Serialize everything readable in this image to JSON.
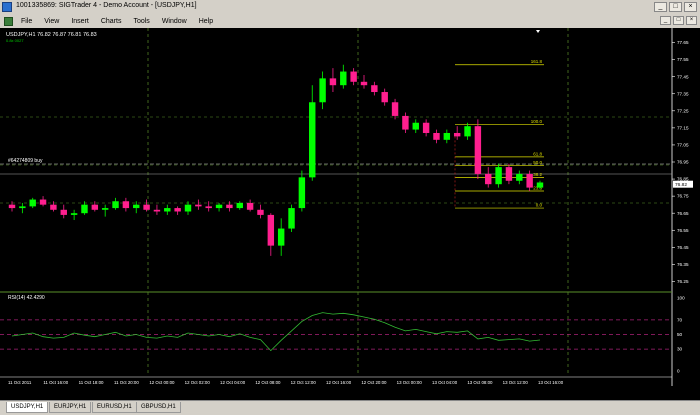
{
  "window": {
    "title": "1001335869: SIGTrader 4 - Demo Account - [USDJPY,H1]",
    "controls": [
      "_",
      "□",
      "×"
    ]
  },
  "menu": {
    "items": [
      "File",
      "View",
      "Insert",
      "Charts",
      "Tools",
      "Window",
      "Help"
    ],
    "doc_controls": [
      "_",
      "□",
      "×"
    ]
  },
  "chart": {
    "header": "USDJPY,H1  76.82  76.87  76.81  76.83",
    "subheader": "0.8x  0027",
    "order_label": "#64274809 buy",
    "current_price": "76.82",
    "price_ticks": [
      "77.65",
      "77.55",
      "77.45",
      "77.35",
      "77.25",
      "77.15",
      "77.05",
      "76.95",
      "76.85",
      "76.75",
      "76.65",
      "76.55",
      "76.45",
      "76.35",
      "76.25"
    ],
    "fib_levels": [
      {
        "label": "161.8",
        "price": 77.52
      },
      {
        "label": "100.0",
        "price": 77.17
      },
      {
        "label": "61.8",
        "price": 76.98
      },
      {
        "label": "50.0",
        "price": 76.93
      },
      {
        "label": "38.2",
        "price": 76.86
      },
      {
        "label": "23.6",
        "price": 76.78
      },
      {
        "label": "0.0",
        "price": 76.68
      }
    ],
    "rsi": {
      "label": "RSI(14) 42.4290",
      "ticks": [
        "100",
        "70",
        "50",
        "30",
        "0"
      ],
      "levels": [
        70,
        50,
        30
      ]
    },
    "time_labels": [
      "11 Oct 2011",
      "11 Oct 16:00",
      "11 Oct 18:00",
      "11 Oct 20:00",
      "12 Oct 00:00",
      "12 Oct 02:00",
      "12 Oct 04:00",
      "12 Oct 08:00",
      "12 Oct 12:00",
      "12 Oct 16:00",
      "12 Oct 20:00",
      "13 Oct 00:00",
      "13 Oct 04:00",
      "13 Oct 08:00",
      "13 Oct 12:00",
      "13 Oct 16:00"
    ],
    "colors": {
      "bull": "#00ff00",
      "bear": "#ff1f8f",
      "grid": "#5a8f2a",
      "axis": "#ffffff",
      "fib": "#e0e000",
      "rsi_line": "#33bb33",
      "rsi_level": "#aa2277"
    }
  },
  "chart_data": {
    "type": "candlestick",
    "title": "USDJPY,H1",
    "ylim": [
      76.2,
      77.7
    ],
    "candles": [
      [
        76.7,
        76.72,
        76.66,
        76.68
      ],
      [
        76.68,
        76.71,
        76.65,
        76.69
      ],
      [
        76.69,
        76.74,
        76.68,
        76.73
      ],
      [
        76.73,
        76.75,
        76.69,
        76.7
      ],
      [
        76.7,
        76.72,
        76.66,
        76.67
      ],
      [
        76.67,
        76.7,
        76.62,
        76.64
      ],
      [
        76.64,
        76.67,
        76.61,
        76.65
      ],
      [
        76.65,
        76.72,
        76.64,
        76.7
      ],
      [
        76.7,
        76.72,
        76.66,
        76.67
      ],
      [
        76.67,
        76.7,
        76.63,
        76.68
      ],
      [
        76.68,
        76.74,
        76.67,
        76.72
      ],
      [
        76.72,
        76.74,
        76.66,
        76.68
      ],
      [
        76.68,
        76.72,
        76.65,
        76.7
      ],
      [
        76.7,
        76.73,
        76.66,
        76.67
      ],
      [
        76.67,
        76.7,
        76.64,
        76.66
      ],
      [
        76.66,
        76.7,
        76.64,
        76.68
      ],
      [
        76.68,
        76.69,
        76.64,
        76.66
      ],
      [
        76.66,
        76.72,
        76.64,
        76.7
      ],
      [
        76.7,
        76.73,
        76.67,
        76.69
      ],
      [
        76.69,
        76.72,
        76.66,
        76.68
      ],
      [
        76.68,
        76.71,
        76.66,
        76.7
      ],
      [
        76.7,
        76.72,
        76.66,
        76.68
      ],
      [
        76.68,
        76.72,
        76.67,
        76.71
      ],
      [
        76.71,
        76.73,
        76.66,
        76.67
      ],
      [
        76.67,
        76.7,
        76.62,
        76.64
      ],
      [
        76.64,
        76.65,
        76.4,
        76.46
      ],
      [
        76.46,
        76.62,
        76.4,
        76.56
      ],
      [
        76.56,
        76.7,
        76.54,
        76.68
      ],
      [
        76.68,
        76.9,
        76.66,
        76.86
      ],
      [
        76.86,
        77.4,
        76.84,
        77.3
      ],
      [
        77.3,
        77.48,
        77.26,
        77.44
      ],
      [
        77.44,
        77.5,
        77.36,
        77.4
      ],
      [
        77.4,
        77.52,
        77.38,
        77.48
      ],
      [
        77.48,
        77.5,
        77.4,
        77.42
      ],
      [
        77.42,
        77.46,
        77.38,
        77.4
      ],
      [
        77.4,
        77.42,
        77.34,
        77.36
      ],
      [
        77.36,
        77.38,
        77.28,
        77.3
      ],
      [
        77.3,
        77.32,
        77.2,
        77.22
      ],
      [
        77.22,
        77.24,
        77.12,
        77.14
      ],
      [
        77.14,
        77.2,
        77.12,
        77.18
      ],
      [
        77.18,
        77.2,
        77.1,
        77.12
      ],
      [
        77.12,
        77.14,
        77.06,
        77.08
      ],
      [
        77.08,
        77.14,
        77.06,
        77.12
      ],
      [
        77.12,
        77.16,
        77.08,
        77.1
      ],
      [
        77.1,
        77.18,
        77.08,
        77.16
      ],
      [
        77.16,
        77.2,
        76.85,
        76.88
      ],
      [
        76.88,
        76.92,
        76.8,
        76.82
      ],
      [
        76.82,
        76.94,
        76.8,
        76.92
      ],
      [
        76.92,
        76.94,
        76.82,
        76.84
      ],
      [
        76.84,
        76.9,
        76.82,
        76.88
      ],
      [
        76.88,
        76.9,
        76.78,
        76.8
      ],
      [
        76.8,
        76.84,
        76.79,
        76.83
      ]
    ],
    "rsi_values": [
      48,
      50,
      52,
      47,
      45,
      46,
      52,
      49,
      47,
      50,
      53,
      48,
      50,
      46,
      45,
      48,
      46,
      52,
      50,
      48,
      50,
      47,
      51,
      46,
      43,
      28,
      42,
      55,
      68,
      76,
      80,
      78,
      79,
      77,
      74,
      71,
      66,
      60,
      55,
      57,
      54,
      51,
      54,
      53,
      55,
      44,
      46,
      42,
      43,
      44,
      41,
      42.43
    ]
  }
}
